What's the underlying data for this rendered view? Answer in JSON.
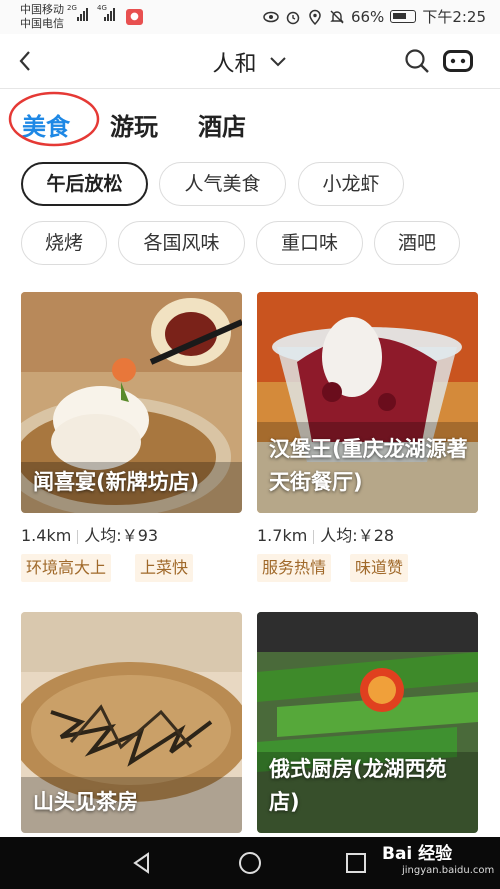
{
  "status_bar": {
    "carrier1": "中国移动",
    "carrier2": "中国电信",
    "net1": "2G",
    "net2": "4G",
    "battery": "66%",
    "time": "下午2:25"
  },
  "nav": {
    "title": "人和"
  },
  "categories": [
    {
      "label": "美食"
    },
    {
      "label": "游玩"
    },
    {
      "label": "酒店"
    }
  ],
  "chips_row1": [
    {
      "label": "午后放松"
    },
    {
      "label": "人气美食"
    },
    {
      "label": "小龙虾"
    }
  ],
  "chips_row2": [
    {
      "label": "烧烤"
    },
    {
      "label": "各国风味"
    },
    {
      "label": "重口味"
    },
    {
      "label": "酒吧"
    }
  ],
  "cards": [
    {
      "name": "闻喜宴(新牌坊店)",
      "distance": "1.4km",
      "avg": "人均:￥93",
      "tags": [
        "环境高大上",
        "上菜快"
      ]
    },
    {
      "name": "汉堡王(重庆龙湖源著天街餐厅)",
      "distance": "1.7km",
      "avg": "人均:￥28",
      "tags": [
        "服务热情",
        "味道赞"
      ]
    },
    {
      "name": "山头见茶房"
    },
    {
      "name": "俄式厨房(龙湖西苑店)"
    }
  ],
  "watermark": {
    "text": "Bai 经验",
    "sub": "jingyan.baidu.com"
  },
  "colors": {
    "accent": "#1e88e5",
    "annotation": "#e53935",
    "tag_bg": "#fdf3e6",
    "tag_text": "#a0692a"
  }
}
